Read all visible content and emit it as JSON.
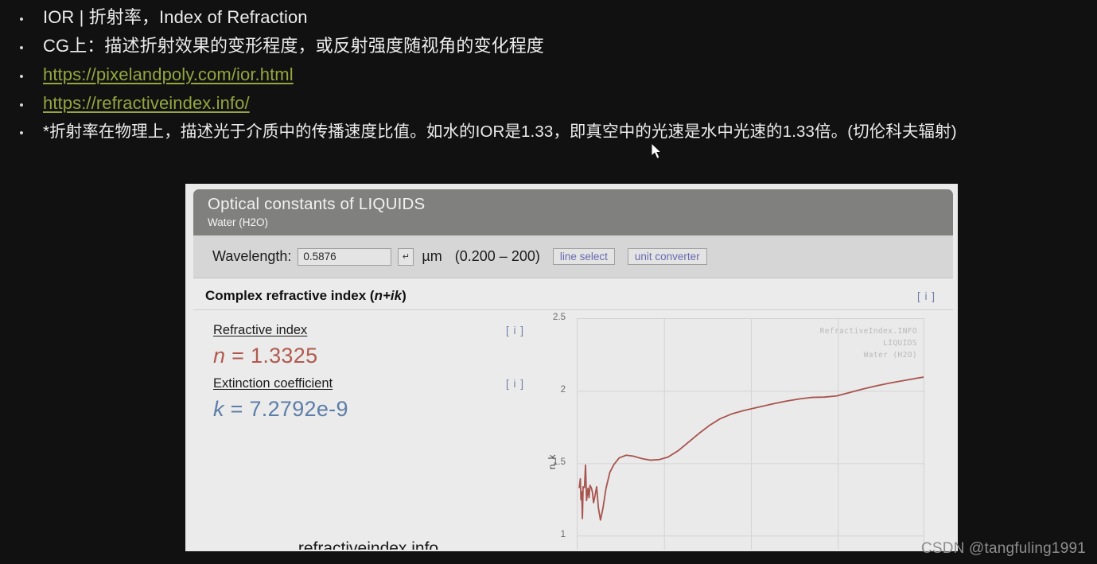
{
  "slide": {
    "bullet_marker": "•",
    "bullets": [
      {
        "text": "IOR | 折射率，Index of Refraction",
        "kind": "text"
      },
      {
        "text": "CG上：描述折射效果的变形程度，或反射强度随视角的变化程度",
        "kind": "text"
      },
      {
        "text": "https://pixelandpoly.com/ior.html",
        "kind": "link"
      },
      {
        "text": "https://refractiveindex.info/",
        "kind": "link"
      },
      {
        "text": "*折射率在物理上，描述光于介质中的传播速度比值。如水的IOR是1.33，即真空中的光速是水中光速的1.33倍。(切伦科夫辐射)",
        "kind": "small"
      }
    ]
  },
  "cursor": {
    "name": "mouse-pointer"
  },
  "site": {
    "title": "Optical constants of LIQUIDS",
    "subtitle": "Water (H2O)",
    "wavelength": {
      "label": "Wavelength:",
      "value": "0.5876",
      "placeholder": "0.5876",
      "enter_glyph": "↵",
      "unit": "µm",
      "range": "(0.200 – 200)",
      "line_select_label": "line select",
      "unit_converter_label": "unit converter"
    },
    "complex_index": {
      "heading_plain": "Complex refractive index (",
      "heading_italic": "n+ik",
      "heading_close": ")",
      "info_label": "[ i ]"
    },
    "values": [
      {
        "label": "Refractive index",
        "symbol": "n",
        "equals": " = ",
        "value": "1.3325",
        "info_label": "[ i ]",
        "color": "#b05a4e"
      },
      {
        "label": "Extinction coefficient",
        "symbol": "k",
        "equals": " = ",
        "value": "7.2792e-9",
        "info_label": "[ i ]",
        "color": "#5d7ea8"
      }
    ],
    "footer_link": "refractiveindex.info"
  },
  "chart_data": {
    "type": "line",
    "title": "",
    "xlabel": "",
    "ylabel": "n, k",
    "ylim": [
      0.85,
      2.5
    ],
    "yticks": [
      2.5,
      2,
      1.5,
      1
    ],
    "ytick_labels": [
      "2.5",
      "2",
      "1.5",
      "1"
    ],
    "grid": true,
    "legend": "none",
    "watermark": [
      "RefractiveIndex.INFO",
      "LIQUIDS",
      "Water (H2O)"
    ],
    "series": [
      {
        "name": "n",
        "color": "#a8544e",
        "points": [
          [
            0.005,
            1.335
          ],
          [
            0.008,
            1.395
          ],
          [
            0.01,
            1.25
          ],
          [
            0.012,
            1.305
          ],
          [
            0.014,
            1.12
          ],
          [
            0.016,
            1.34
          ],
          [
            0.02,
            1.335
          ],
          [
            0.023,
            1.49
          ],
          [
            0.026,
            1.245
          ],
          [
            0.03,
            1.33
          ],
          [
            0.033,
            1.265
          ],
          [
            0.036,
            1.35
          ],
          [
            0.04,
            1.33
          ],
          [
            0.043,
            1.3
          ],
          [
            0.046,
            1.23
          ],
          [
            0.05,
            1.275
          ],
          [
            0.055,
            1.34
          ],
          [
            0.06,
            1.195
          ],
          [
            0.066,
            1.11
          ],
          [
            0.073,
            1.19
          ],
          [
            0.082,
            1.33
          ],
          [
            0.093,
            1.44
          ],
          [
            0.105,
            1.495
          ],
          [
            0.12,
            1.54
          ],
          [
            0.14,
            1.558
          ],
          [
            0.16,
            1.552
          ],
          [
            0.185,
            1.535
          ],
          [
            0.21,
            1.524
          ],
          [
            0.235,
            1.528
          ],
          [
            0.26,
            1.545
          ],
          [
            0.29,
            1.59
          ],
          [
            0.32,
            1.65
          ],
          [
            0.35,
            1.71
          ],
          [
            0.38,
            1.765
          ],
          [
            0.41,
            1.81
          ],
          [
            0.445,
            1.845
          ],
          [
            0.48,
            1.868
          ],
          [
            0.52,
            1.89
          ],
          [
            0.56,
            1.912
          ],
          [
            0.6,
            1.932
          ],
          [
            0.64,
            1.948
          ],
          [
            0.675,
            1.958
          ],
          [
            0.71,
            1.96
          ],
          [
            0.745,
            1.968
          ],
          [
            0.78,
            1.99
          ],
          [
            0.82,
            2.015
          ],
          [
            0.86,
            2.038
          ],
          [
            0.9,
            2.058
          ],
          [
            0.94,
            2.075
          ],
          [
            0.975,
            2.09
          ],
          [
            1.0,
            2.1
          ]
        ]
      }
    ]
  },
  "watermark": {
    "text": "CSDN @tangfuling1991"
  }
}
